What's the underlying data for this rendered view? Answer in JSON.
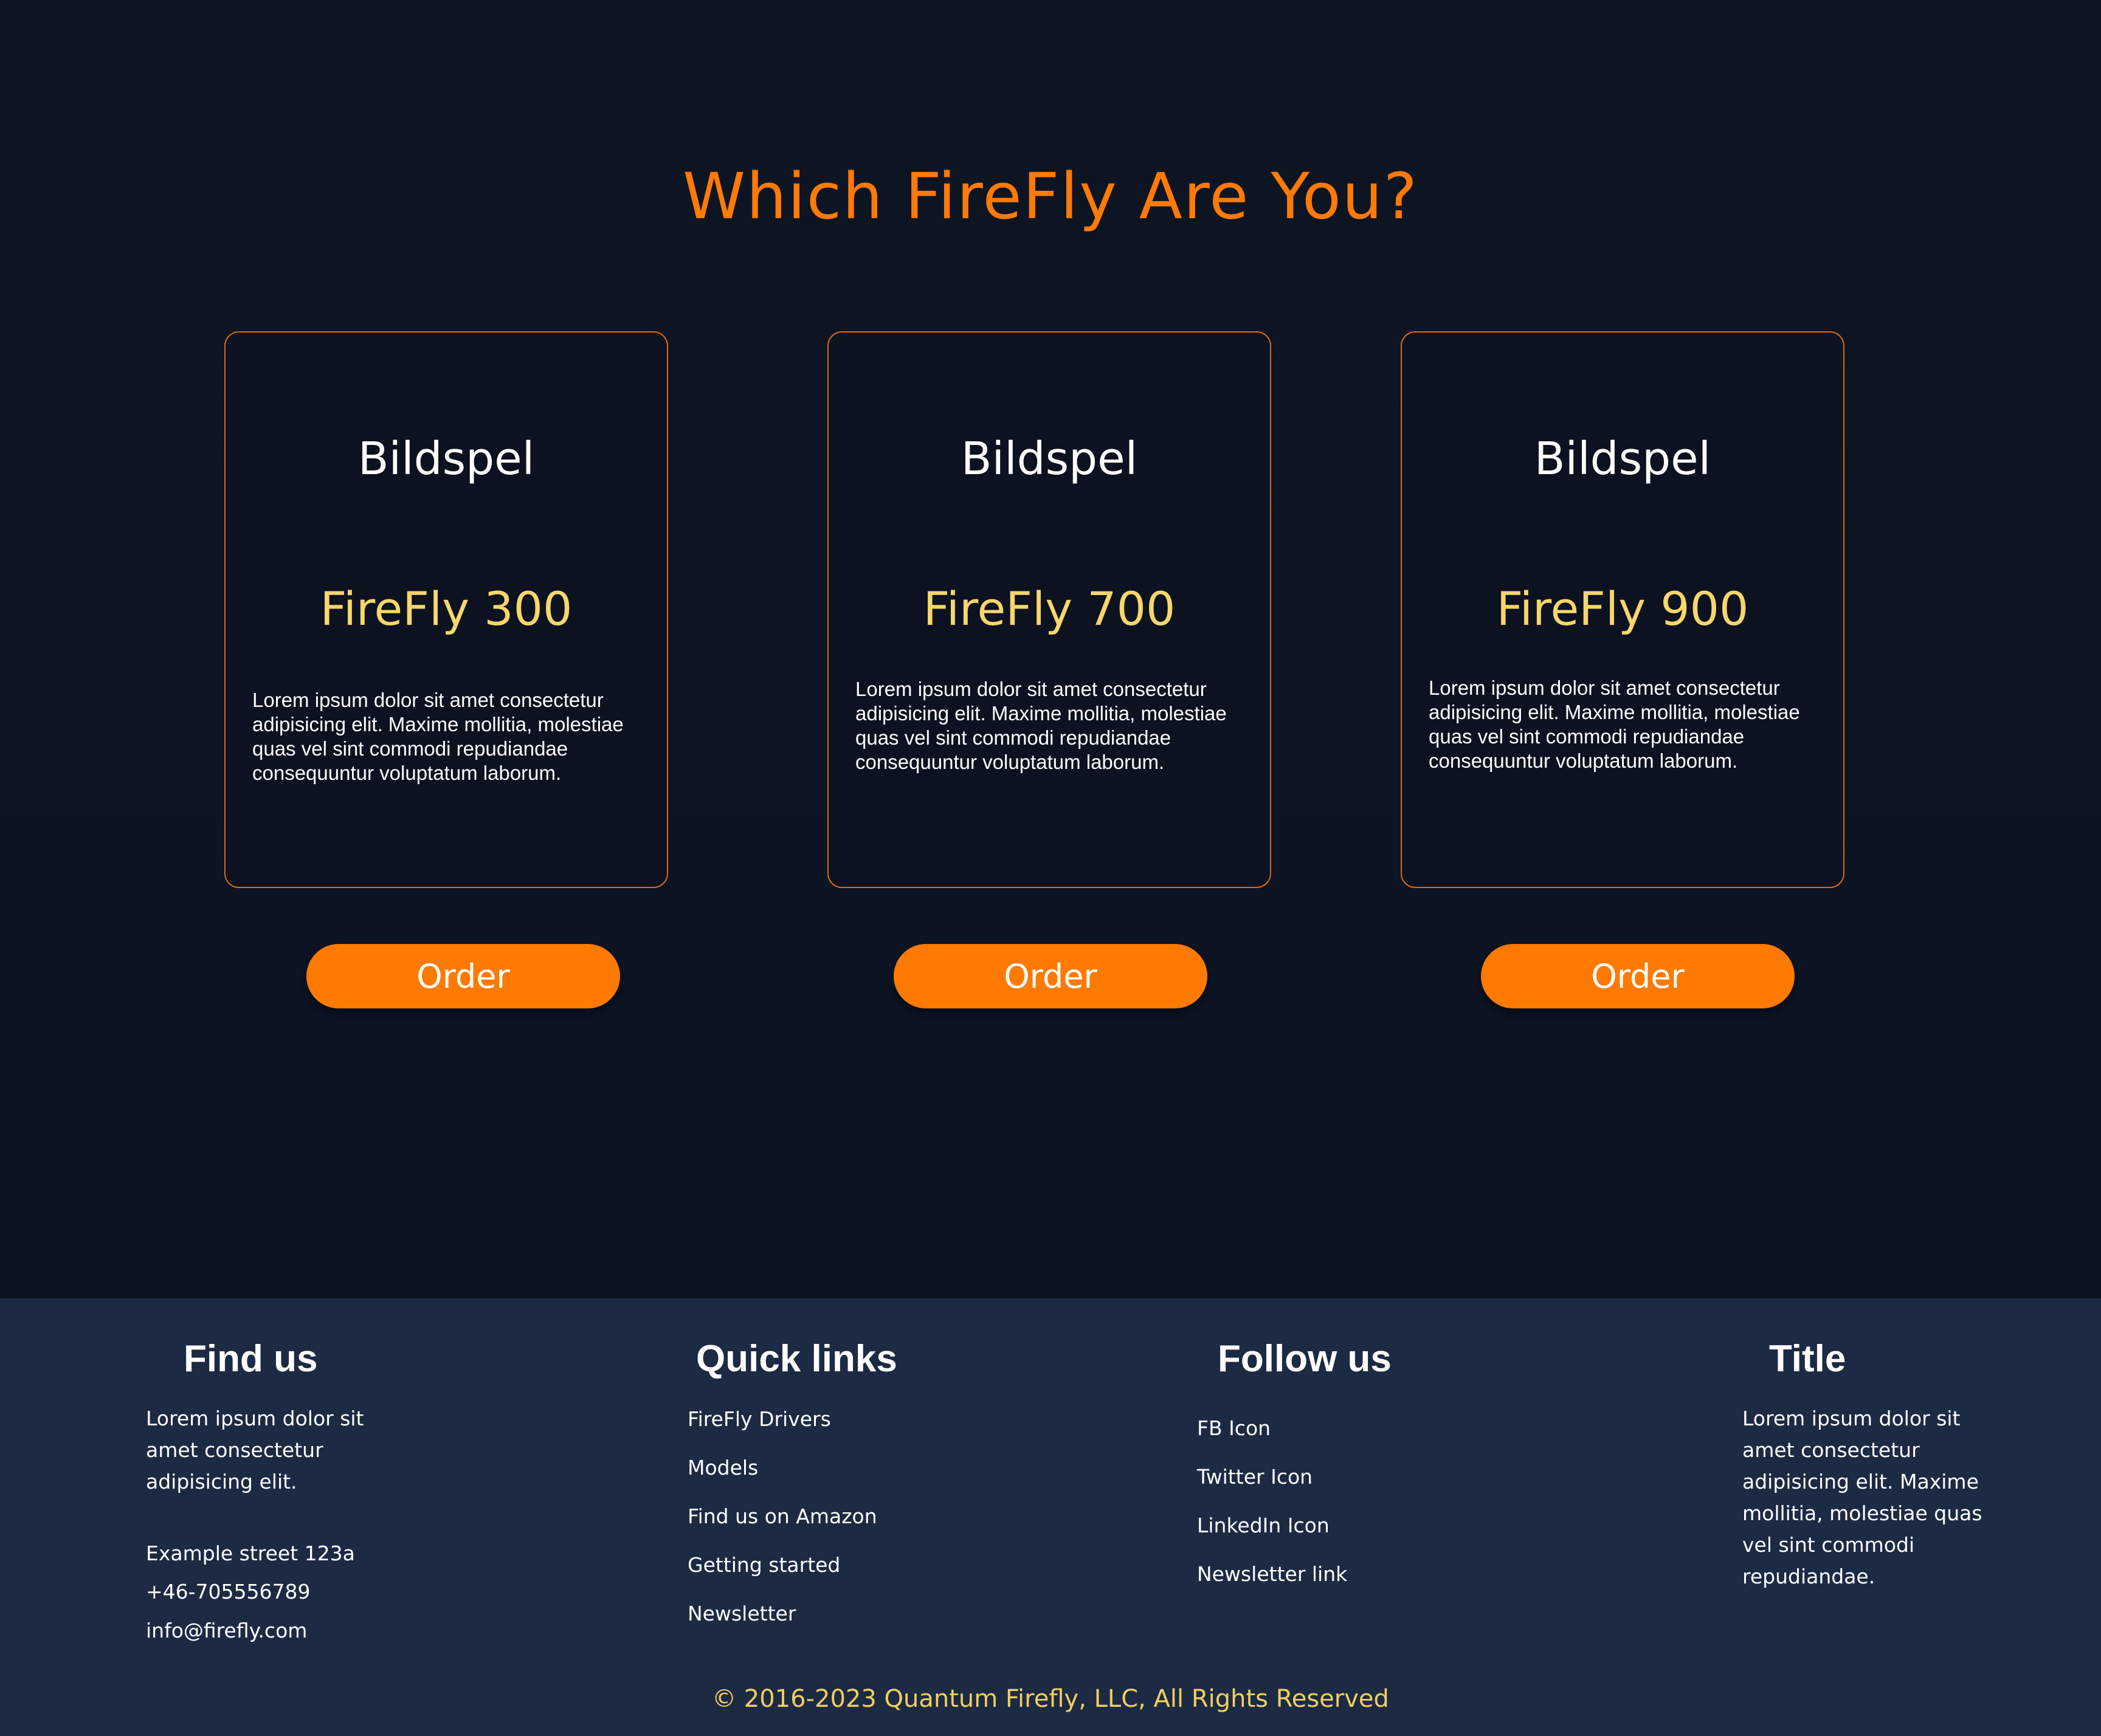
{
  "hero": {
    "title": "Which FireFly Are You?"
  },
  "cards": [
    {
      "brand": "Bildspel",
      "model": "FireFly 300",
      "description": "Lorem ipsum dolor sit amet consectetur adipisicing elit. Maxime mollitia, molestiae quas vel sint commodi repudiandae consequuntur voluptatum laborum.",
      "order_label": "Order"
    },
    {
      "brand": "Bildspel",
      "model": "FireFly 700",
      "description": "Lorem ipsum dolor sit amet consectetur adipisicing elit. Maxime mollitia, molestiae quas vel sint commodi repudiandae consequuntur voluptatum laborum.",
      "order_label": "Order"
    },
    {
      "brand": "Bildspel",
      "model": "FireFly 900",
      "description": "Lorem ipsum dolor sit amet consectetur adipisicing elit. Maxime mollitia, molestiae quas vel sint commodi repudiandae consequuntur voluptatum laborum.",
      "order_label": "Order"
    }
  ],
  "footer": {
    "find_us": {
      "title": "Find us",
      "text": "Lorem ipsum dolor sit amet consectetur adipisicing elit.",
      "address": "Example street 123a",
      "phone": "+46-705556789",
      "email": "info@firefly.com"
    },
    "quick_links": {
      "title": "Quick links",
      "items": [
        "FireFly Drivers",
        "Models",
        "Find us on Amazon",
        "Getting started",
        "Newsletter"
      ]
    },
    "follow_us": {
      "title": "Follow us",
      "items": [
        "FB Icon",
        "Twitter Icon",
        "LinkedIn Icon",
        "Newsletter link"
      ]
    },
    "extra": {
      "title": "Title",
      "text": "Lorem ipsum dolor sit amet consectetur adipisicing elit. Maxime mollitia, molestiae quas vel sint commodi repudiandae."
    },
    "copyright": "© 2016-2023 Quantum Firefly, LLC, All Rights Reserved"
  },
  "colors": {
    "background": "#0c1220",
    "accent": "#ff7a00",
    "model_text": "#f8d66c",
    "footer_bg": "#1c2a44",
    "copyright_text": "#f0cf5e"
  }
}
